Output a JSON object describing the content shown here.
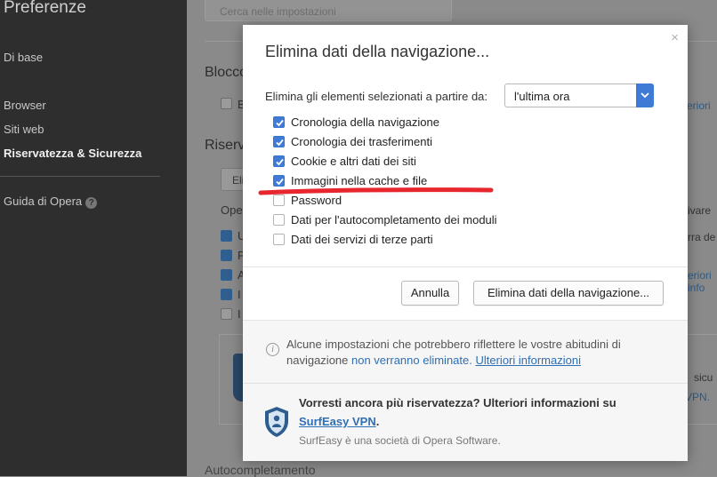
{
  "sidebar": {
    "title": "Preferenze",
    "items": [
      {
        "label": "Di base"
      },
      {
        "label": "Browser"
      },
      {
        "label": "Siti web"
      },
      {
        "label": "Riservatezza & Sicurezza"
      },
      {
        "label": "Guida di Opera"
      }
    ],
    "help_glyph": "?"
  },
  "background": {
    "search_placeholder": "Cerca nelle impostazioni",
    "section_block": "Blocco",
    "section_privacy": "Riserva",
    "autocomplete_heading": "Autocompletamento",
    "clear_button_fragment": "Eli",
    "ope_fragment": "Ope",
    "row_fragments": [
      "U",
      "P",
      "A",
      "I",
      "I"
    ],
    "right_fragments": [
      "eriori",
      "ivare",
      "rra de",
      "eriori info",
      "sicu",
      "VPN."
    ],
    "b_fragment": "B"
  },
  "dialog": {
    "title": "Elimina dati della navigazione...",
    "close_glyph": "×",
    "range_label": "Elimina gli elementi selezionati a partire da:",
    "range_value": "l'ultima ora",
    "options": [
      {
        "label": "Cronologia della navigazione",
        "checked": true
      },
      {
        "label": "Cronologia dei trasferimenti",
        "checked": true
      },
      {
        "label": "Cookie e altri dati dei siti",
        "checked": true
      },
      {
        "label": "Immagini nella cache e file",
        "checked": true
      },
      {
        "label": "Password",
        "checked": false
      },
      {
        "label": "Dati per l'autocompletamento dei moduli",
        "checked": false
      },
      {
        "label": "Dati dei servizi di terze parti",
        "checked": false
      }
    ],
    "cancel_label": "Annulla",
    "confirm_label": "Elimina dati della navigazione...",
    "info": {
      "text_part1": "Alcune impostazioni che potrebbero riflettere le vostre abitudini di navigazione ",
      "text_part2": "non verranno eliminate.",
      "link": "Ulteriori informazioni"
    },
    "vpn": {
      "title": "Vorresti ancora più riservatezza? Ulteriori informazioni su",
      "link": "SurfEasy VPN",
      "after_link": ".",
      "subtitle": "SurfEasy è una società di Opera Software."
    }
  },
  "colors": {
    "accent": "#3f7bd6",
    "link": "#2f6fb3",
    "highlight_stroke": "#e8262e"
  }
}
